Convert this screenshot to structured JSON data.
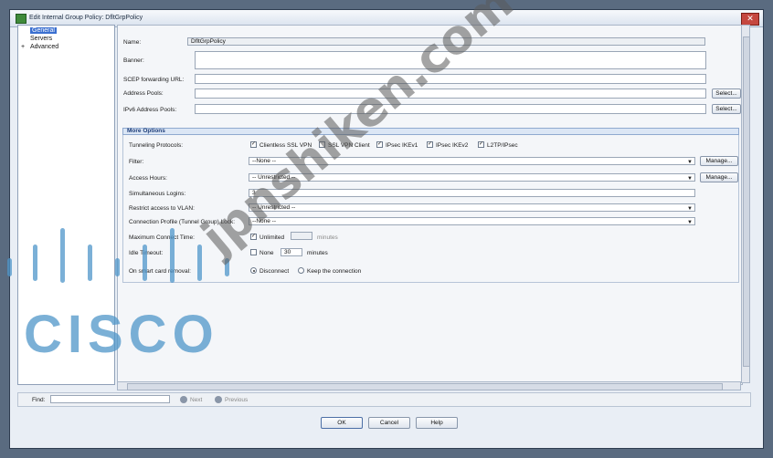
{
  "window": {
    "title": "Edit Internal Group Policy: DfltGrpPolicy"
  },
  "tree": {
    "items": [
      {
        "label": "General",
        "selected": true
      },
      {
        "label": "Servers"
      },
      {
        "label": "Advanced",
        "expander": "+"
      }
    ]
  },
  "form": {
    "name_label": "Name:",
    "name_value": "DfltGrpPolicy",
    "banner_label": "Banner:",
    "scep_label": "SCEP forwarding URL:",
    "address_pools_label": "Address Pools:",
    "ipv6_pools_label": "IPv6 Address Pools:",
    "select_label": "Select..."
  },
  "more_options": {
    "header": "More Options",
    "tunneling_label": "Tunneling Protocols:",
    "protocols": [
      {
        "label": "Clientless SSL VPN",
        "checked": true
      },
      {
        "label": "SSL VPN Client",
        "checked": false
      },
      {
        "label": "IPsec IKEv1",
        "checked": true
      },
      {
        "label": "IPsec IKEv2",
        "checked": true
      },
      {
        "label": "L2TP/IPsec",
        "checked": true
      }
    ],
    "filter_label": "Filter:",
    "filter_value": "--None --",
    "access_hours_label": "Access Hours:",
    "access_hours_value": "-- Unrestricted --",
    "manage_label": "Manage...",
    "simul_logins_label": "Simultaneous Logins:",
    "simul_logins_value": "3",
    "restrict_vlan_label": "Restrict access to VLAN:",
    "restrict_vlan_value": "-- Unrestricted --",
    "conn_profile_label": "Connection Profile (Tunnel Group) Lock:",
    "conn_profile_value": "--None --",
    "max_connect_label": "Maximum Connect Time:",
    "max_connect_unlimited": "Unlimited",
    "max_connect_units": "minutes",
    "idle_timeout_label": "Idle Timeout:",
    "idle_none": "None",
    "idle_value": "30",
    "idle_units": "minutes",
    "smart_card_label": "On smart card removal:",
    "smart_card_options": [
      {
        "label": "Disconnect",
        "selected": true
      },
      {
        "label": "Keep the connection",
        "selected": false
      }
    ]
  },
  "find": {
    "label": "Find:",
    "next": "Next",
    "previous": "Previous"
  },
  "buttons": {
    "ok": "OK",
    "cancel": "Cancel",
    "help": "Help"
  },
  "overlay": {
    "logo_text": "CISCO",
    "watermark_text": "jpnshiken.com"
  },
  "colors": {
    "accent": "#1d3d79",
    "logo": "#4f96c9"
  }
}
